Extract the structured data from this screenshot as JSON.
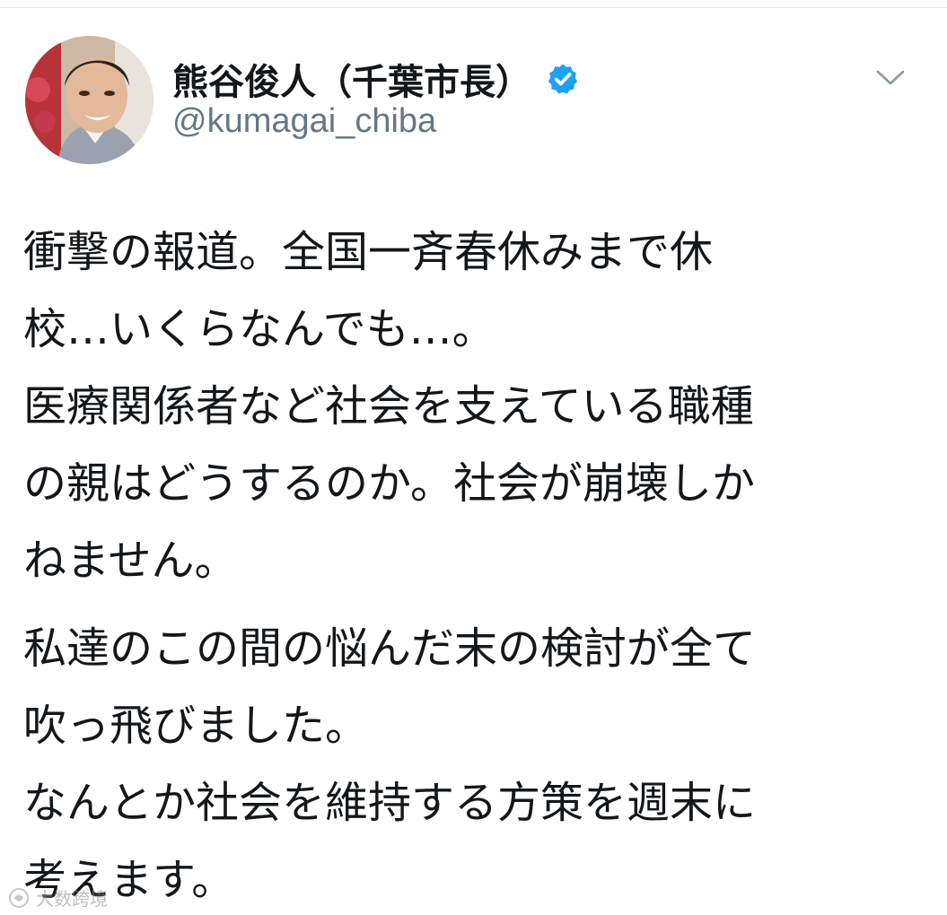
{
  "tweet": {
    "author": {
      "display_name": "熊谷俊人（千葉市長）",
      "handle": "@kumagai_chiba",
      "verified": true,
      "avatar_icon": "profile-photo"
    },
    "menu_icon": "chevron-down-icon",
    "paragraphs": [
      {
        "lines": [
          "衝撃の報道。全国一斉春休みまで休",
          "校…いくらなんでも…。",
          "医療関係者など社会を支えている職種",
          "の親はどうするのか。社会が崩壊しか",
          "ねません。"
        ]
      },
      {
        "lines": [
          "私達のこの間の悩んだ末の検討が全て",
          "吹っ飛びました。",
          "なんとか社会を維持する方策を週末に",
          "考えます。"
        ]
      }
    ]
  },
  "watermark": {
    "text": "大数跨境"
  },
  "colors": {
    "text": "#14171a",
    "secondary": "#657786",
    "verified": "#1da1f2",
    "background": "#ffffff"
  }
}
